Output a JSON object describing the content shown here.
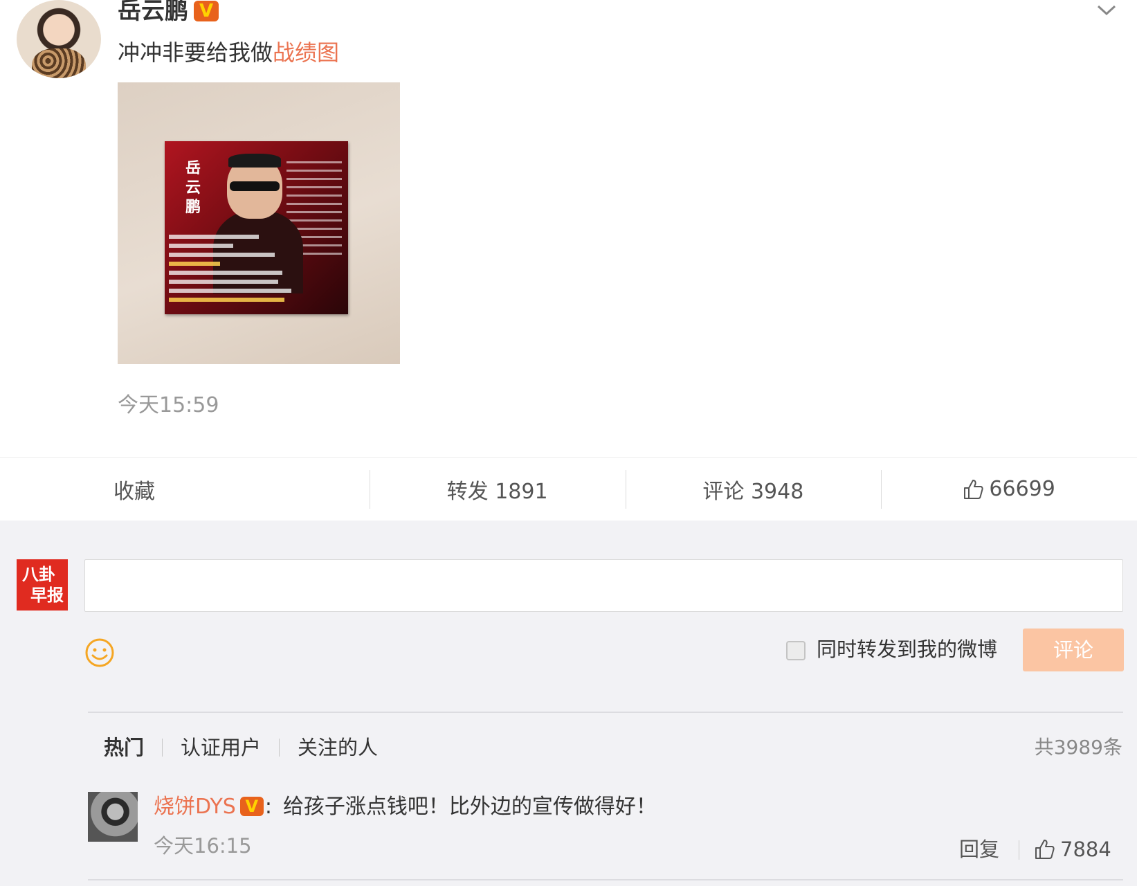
{
  "post": {
    "author": "岳云鹏",
    "verified_badge": "V",
    "text_plain": "冲冲非要给我做",
    "text_link": "战绩图",
    "poster_title_chars": [
      "岳",
      "云",
      "鹏"
    ],
    "timestamp": "今天15:59"
  },
  "actions": {
    "favorite": "收藏",
    "repost": "转发 1891",
    "comment": "评论 3948",
    "like": "66699"
  },
  "composer": {
    "avatar_text_1": "八卦",
    "avatar_text_2": "早报",
    "repost_label": "同时转发到我的微博",
    "submit_label": "评论"
  },
  "filters": {
    "hot": "热门",
    "verified": "认证用户",
    "following": "关注的人",
    "total": "共3989条"
  },
  "comment": {
    "name": "烧饼DYS",
    "badge": "V",
    "colon": ":",
    "text": "给孩子涨点钱吧！比外边的宣传做得好！",
    "time": "今天16:15",
    "reply": "回复",
    "likes": "7884"
  },
  "colors": {
    "accent": "#eb7350",
    "verified": "#e8621c",
    "submit_disabled": "#fbc5a3",
    "comment_bg": "#f2f2f5"
  }
}
